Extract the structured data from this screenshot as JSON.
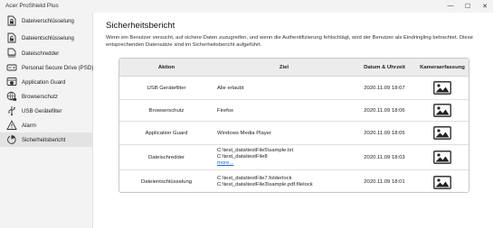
{
  "app": {
    "title": "Acer ProShield Plus",
    "controls": {
      "minimize": "—",
      "maximize": "☐",
      "close": "✕"
    }
  },
  "sidebar": {
    "items": [
      {
        "label": "Dateiverschlüsselung",
        "icon": "file-lock-icon"
      },
      {
        "label": "Dateientschlüsselung",
        "icon": "file-unlock-icon"
      },
      {
        "label": "Dateischredder",
        "icon": "file-shredder-icon"
      },
      {
        "label": "Personal Secure Drive (PSD)",
        "icon": "secure-drive-icon"
      },
      {
        "label": "Application Guard",
        "icon": "app-guard-icon"
      },
      {
        "label": "Browserschutz",
        "icon": "globe-lock-icon"
      },
      {
        "label": "USB Gerätefilter",
        "icon": "usb-icon"
      },
      {
        "label": "Alarm",
        "icon": "alert-triangle-icon"
      },
      {
        "label": "Sicherheitsbericht",
        "icon": "security-report-icon",
        "active": true
      }
    ]
  },
  "main": {
    "title": "Sicherheitsbericht",
    "description": "Wenn ein Benutzer versucht, auf sichere Daten zuzugreifen, und wenn die Authentifizierung fehlschlägt, wird der Benutzer als Eindringling betrachtet. Diese entsprechenden Datensätze sind im Sicherheitsbericht aufgeführt.",
    "table": {
      "headers": {
        "action": "Aktion",
        "target": "Ziel",
        "datetime": "Datum & Uhrzeit",
        "camera": "Kameraerfassung"
      },
      "rows": [
        {
          "action": "USB Gerätefilter",
          "target": [
            "Alle erlaubt"
          ],
          "datetime": "2020.11.09 18:07"
        },
        {
          "action": "Browserschutz",
          "target": [
            "Firefox"
          ],
          "datetime": "2020.11.09 18:06"
        },
        {
          "action": "Application Guard",
          "target": [
            "Windows Media Player"
          ],
          "datetime": "2020.11.09 18:05"
        },
        {
          "action": "Dateischredder",
          "target": [
            "C:\\test_data\\testFile5\\sample.txt",
            "C:\\test_data\\testFile8"
          ],
          "more": "more...",
          "datetime": "2020.11.09 18:03"
        },
        {
          "action": "Dateientschlüsselung",
          "target": [
            "C:\\test_data\\testFile7.folderlock",
            "C:\\test_data\\testFile3\\sample.pdf.filelock"
          ],
          "datetime": "2020.11.09 18:01"
        }
      ]
    }
  }
}
